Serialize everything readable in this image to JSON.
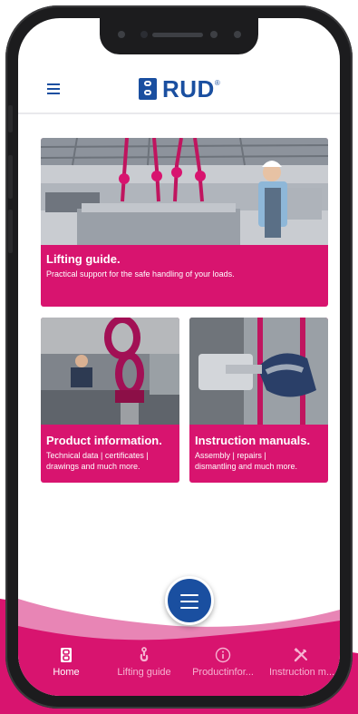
{
  "brand": {
    "logo_text": "RUD",
    "registered": "®"
  },
  "cards": [
    {
      "title": "Lifting guide.",
      "description": "Practical support for the safe handling of your loads."
    },
    {
      "title": "Product information.",
      "description_lines": [
        "Technical data | certificates |",
        "drawings and much more."
      ]
    },
    {
      "title": "Instruction manuals.",
      "description_lines": [
        "Assembly | repairs |",
        "dismantling and much more."
      ]
    }
  ],
  "tabs": [
    {
      "label": "Home",
      "icon": "rud-logo-icon",
      "active": true
    },
    {
      "label": "Lifting guide",
      "icon": "hook-icon",
      "active": false
    },
    {
      "label": "Productinfor...",
      "icon": "info-icon",
      "active": false
    },
    {
      "label": "Instruction m...",
      "icon": "tools-icon",
      "active": false
    }
  ],
  "colors": {
    "accent": "#d8146f",
    "brand_blue": "#1a4fa0",
    "tab_active": "#ffffff",
    "tab_inactive": "#f6b3d1"
  }
}
